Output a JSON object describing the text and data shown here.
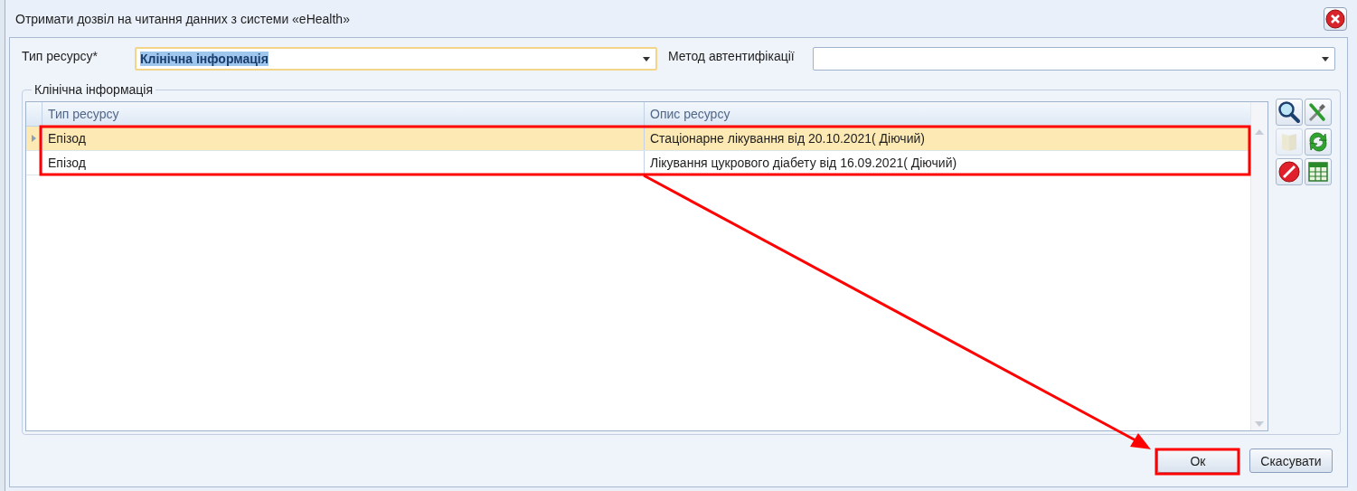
{
  "window": {
    "title": "Отримати дозвіл на читання данних з системи «eHealth»"
  },
  "fields": [
    {
      "label": "Тип ресурсу*",
      "value": "Клінічна інформація",
      "focused": true
    },
    {
      "label": "Метод автентифікації",
      "focused": false
    }
  ],
  "group": {
    "title": "Клінічна інформація"
  },
  "table": {
    "columns": [
      "Тип ресурсу",
      "Опис ресурсу"
    ],
    "rows": [
      {
        "cells": [
          "Епізод",
          "Стаціонарне лікування від 20.10.2021( Діючий)"
        ],
        "selected": true
      },
      {
        "cells": [
          "Епізод",
          "Лікування цукрового діабету від 16.09.2021( Діючий)"
        ],
        "selected": false
      }
    ]
  },
  "toolbar": [
    {
      "kind": "search",
      "disabled": false
    },
    {
      "kind": "tools",
      "disabled": false
    },
    {
      "kind": "book",
      "disabled": true
    },
    {
      "kind": "refresh",
      "disabled": false
    },
    {
      "kind": "delete",
      "disabled": false
    },
    {
      "kind": "table",
      "disabled": false
    }
  ],
  "buttons": [
    "Ок",
    "Скасувати"
  ]
}
